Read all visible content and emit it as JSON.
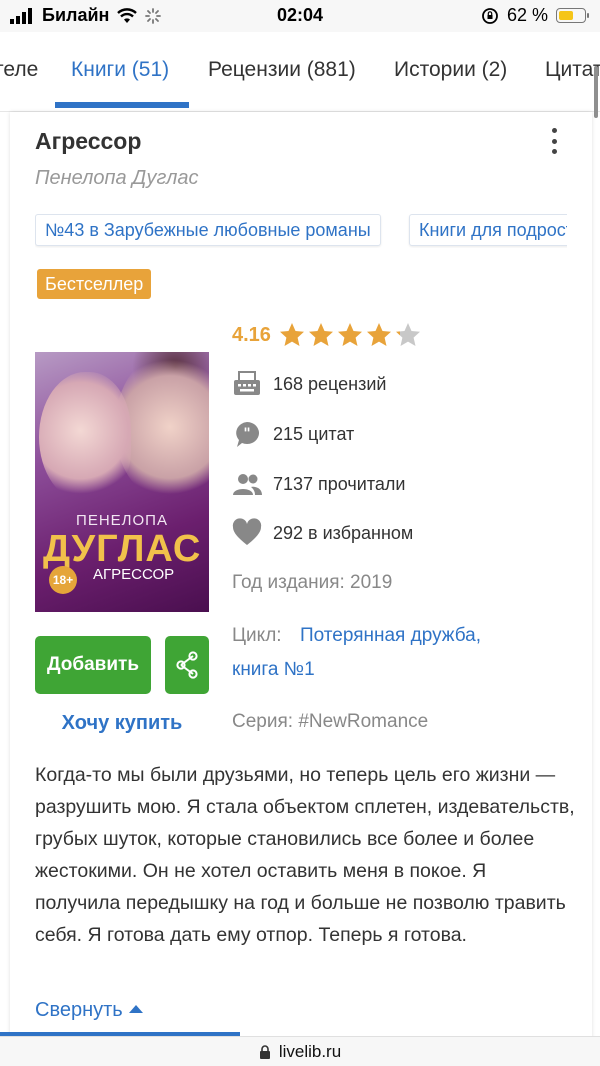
{
  "status_bar": {
    "carrier": "Билайн",
    "time": "02:04",
    "battery_percent": "62 %",
    "battery_level": 0.62
  },
  "tabs": [
    {
      "label": "теле"
    },
    {
      "label": "Книги (51)",
      "active": true
    },
    {
      "label": "Рецензии (881)"
    },
    {
      "label": "Истории (2)"
    },
    {
      "label": "Цитаты"
    }
  ],
  "book": {
    "title": "Агрессор",
    "author": "Пенелопа Дуглас",
    "tags": [
      "№43 в Зарубежные любовные романы",
      "Книги для подростков"
    ],
    "badge": "Бестселлер",
    "cover": {
      "author_first": "ПЕНЕЛОПА",
      "author_last": "ДУГЛАС",
      "title": "АГРЕССОР",
      "age": "18+"
    },
    "rating": "4.16",
    "rating_stars": 4.16,
    "stats": {
      "reviews": "168 рецензий",
      "quotes": "215 цитат",
      "readers": "7137 прочитали",
      "favorites": "292 в избранном"
    },
    "year": "Год издания: 2019",
    "cycle_label": "Цикл:",
    "cycle_link_line1": "Потерянная дружба,",
    "cycle_link_line2": "книга №1",
    "series": "Серия: #NewRomance",
    "description": "Когда-то мы были друзьями, но теперь цель его жизни — разрушить мою. Я стала объектом сплетен, издевательств, грубых шуток, которые становились все более и более жестокими. Он не хотел оставить меня в покое. Я получила передышку на год и больше не позволю травить себя. Я готова дать ему отпор. Теперь я готова."
  },
  "actions": {
    "add": "Добавить",
    "want_buy": "Хочу купить",
    "collapse": "Свернуть"
  },
  "browser": {
    "url": "livelib.ru",
    "load_progress": 0.4
  },
  "colors": {
    "accent": "#2f73c6",
    "green": "#3fa535",
    "orange": "#e8a33a"
  }
}
